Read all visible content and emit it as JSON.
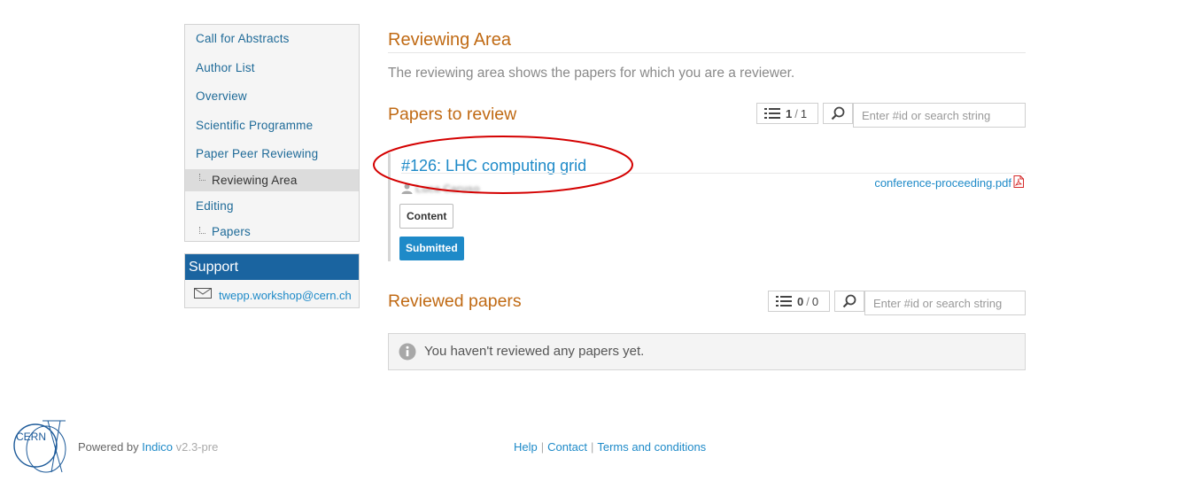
{
  "sidebar": {
    "items": [
      {
        "label": "Call for Abstracts"
      },
      {
        "label": "Author List"
      },
      {
        "label": "Overview"
      },
      {
        "label": "Scientific Programme"
      },
      {
        "label": "Paper Peer Reviewing"
      },
      {
        "label": "Reviewing Area",
        "active": true
      },
      {
        "label": "Editing"
      },
      {
        "label": "Papers"
      }
    ],
    "support": {
      "title": "Support",
      "email": "twepp.workshop@cern.ch"
    }
  },
  "main": {
    "title": "Reviewing Area",
    "description": "The reviewing area shows the papers for which you are a reviewer.",
    "to_review": {
      "title": "Papers to review",
      "count_shown": "1",
      "count_total": "1",
      "search_placeholder": "Enter #id or search string",
      "papers": [
        {
          "title": "#126: LHC computing grid",
          "author": "Luca Caruso",
          "file": "conference-proceeding.pdf",
          "tags": [
            "Content",
            "Submitted"
          ]
        }
      ]
    },
    "reviewed": {
      "title": "Reviewed papers",
      "count_shown": "0",
      "count_total": "0",
      "search_placeholder": "Enter #id or search string",
      "empty_message": "You haven't reviewed any papers yet."
    }
  },
  "footer": {
    "logo_text": "CERN",
    "powered_by": "Powered by",
    "indico": "Indico",
    "version": "v2.3-pre",
    "links": [
      "Help",
      "Contact",
      "Terms and conditions"
    ]
  },
  "colors": {
    "accent_orange": "#c06a14",
    "link_blue": "#1e8ac8",
    "support_header": "#1a64a0",
    "highlight_red": "#d40000"
  }
}
